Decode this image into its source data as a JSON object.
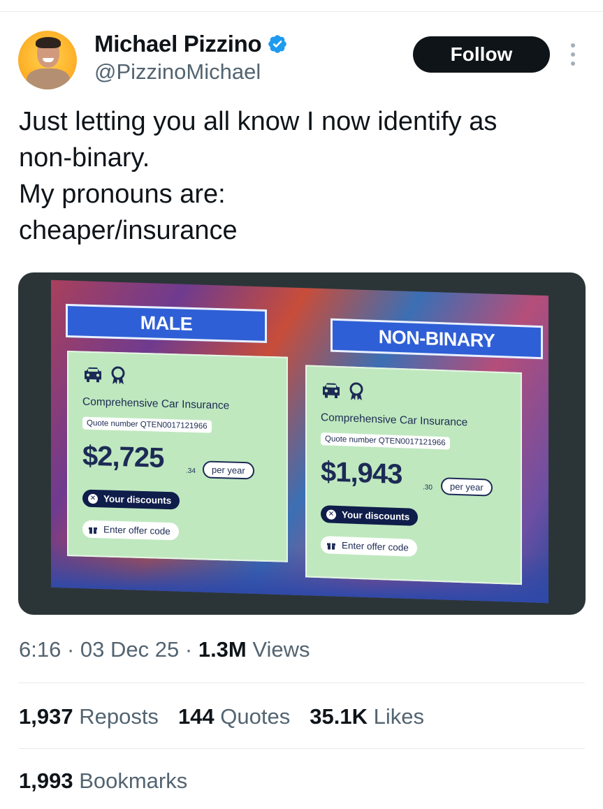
{
  "author": {
    "display_name": "Michael Pizzino",
    "handle": "@PizzinoMichael",
    "verified": true
  },
  "follow_label": "Follow",
  "tweet_lines": [
    "Just letting you all know I now identify as",
    "non-binary.",
    "My pronouns are:",
    "cheaper/insurance"
  ],
  "media": {
    "left_quote": {
      "label": "MALE",
      "product": "Comprehensive Car Insurance",
      "quote_number": "Quote number QTEN0017121966",
      "price": "$2,725",
      "cents": ".34",
      "per_year": "per year",
      "discounts": "Your discounts",
      "offer_code": "Enter offer code"
    },
    "right_quote": {
      "label": "NON-BINARY",
      "product": "Comprehensive Car Insurance",
      "quote_number": "Quote number QTEN0017121966",
      "price": "$1,943",
      "cents": ".30",
      "per_year": "per year",
      "discounts": "Your discounts",
      "offer_code": "Enter offer code"
    }
  },
  "meta": {
    "time": "6:16",
    "date": "03 Dec 25",
    "views_count": "1.3M",
    "views_label": "Views",
    "separator": "·"
  },
  "stats": {
    "reposts_count": "1,937",
    "reposts_label": "Reposts",
    "quotes_count": "144",
    "quotes_label": "Quotes",
    "likes_count": "35.1K",
    "likes_label": "Likes",
    "bookmarks_count": "1,993",
    "bookmarks_label": "Bookmarks"
  },
  "colors": {
    "verified_blue": "#1d9bf0",
    "follow_bg": "#0f1419",
    "secondary_text": "#536471",
    "card_green": "#bfe8bf",
    "label_blue": "#2f5fd6"
  },
  "icons": {
    "verified": "verified-badge-icon",
    "more": "more-dots-icon",
    "car": "car-icon",
    "award": "award-badge-icon",
    "gift": "gift-icon"
  }
}
